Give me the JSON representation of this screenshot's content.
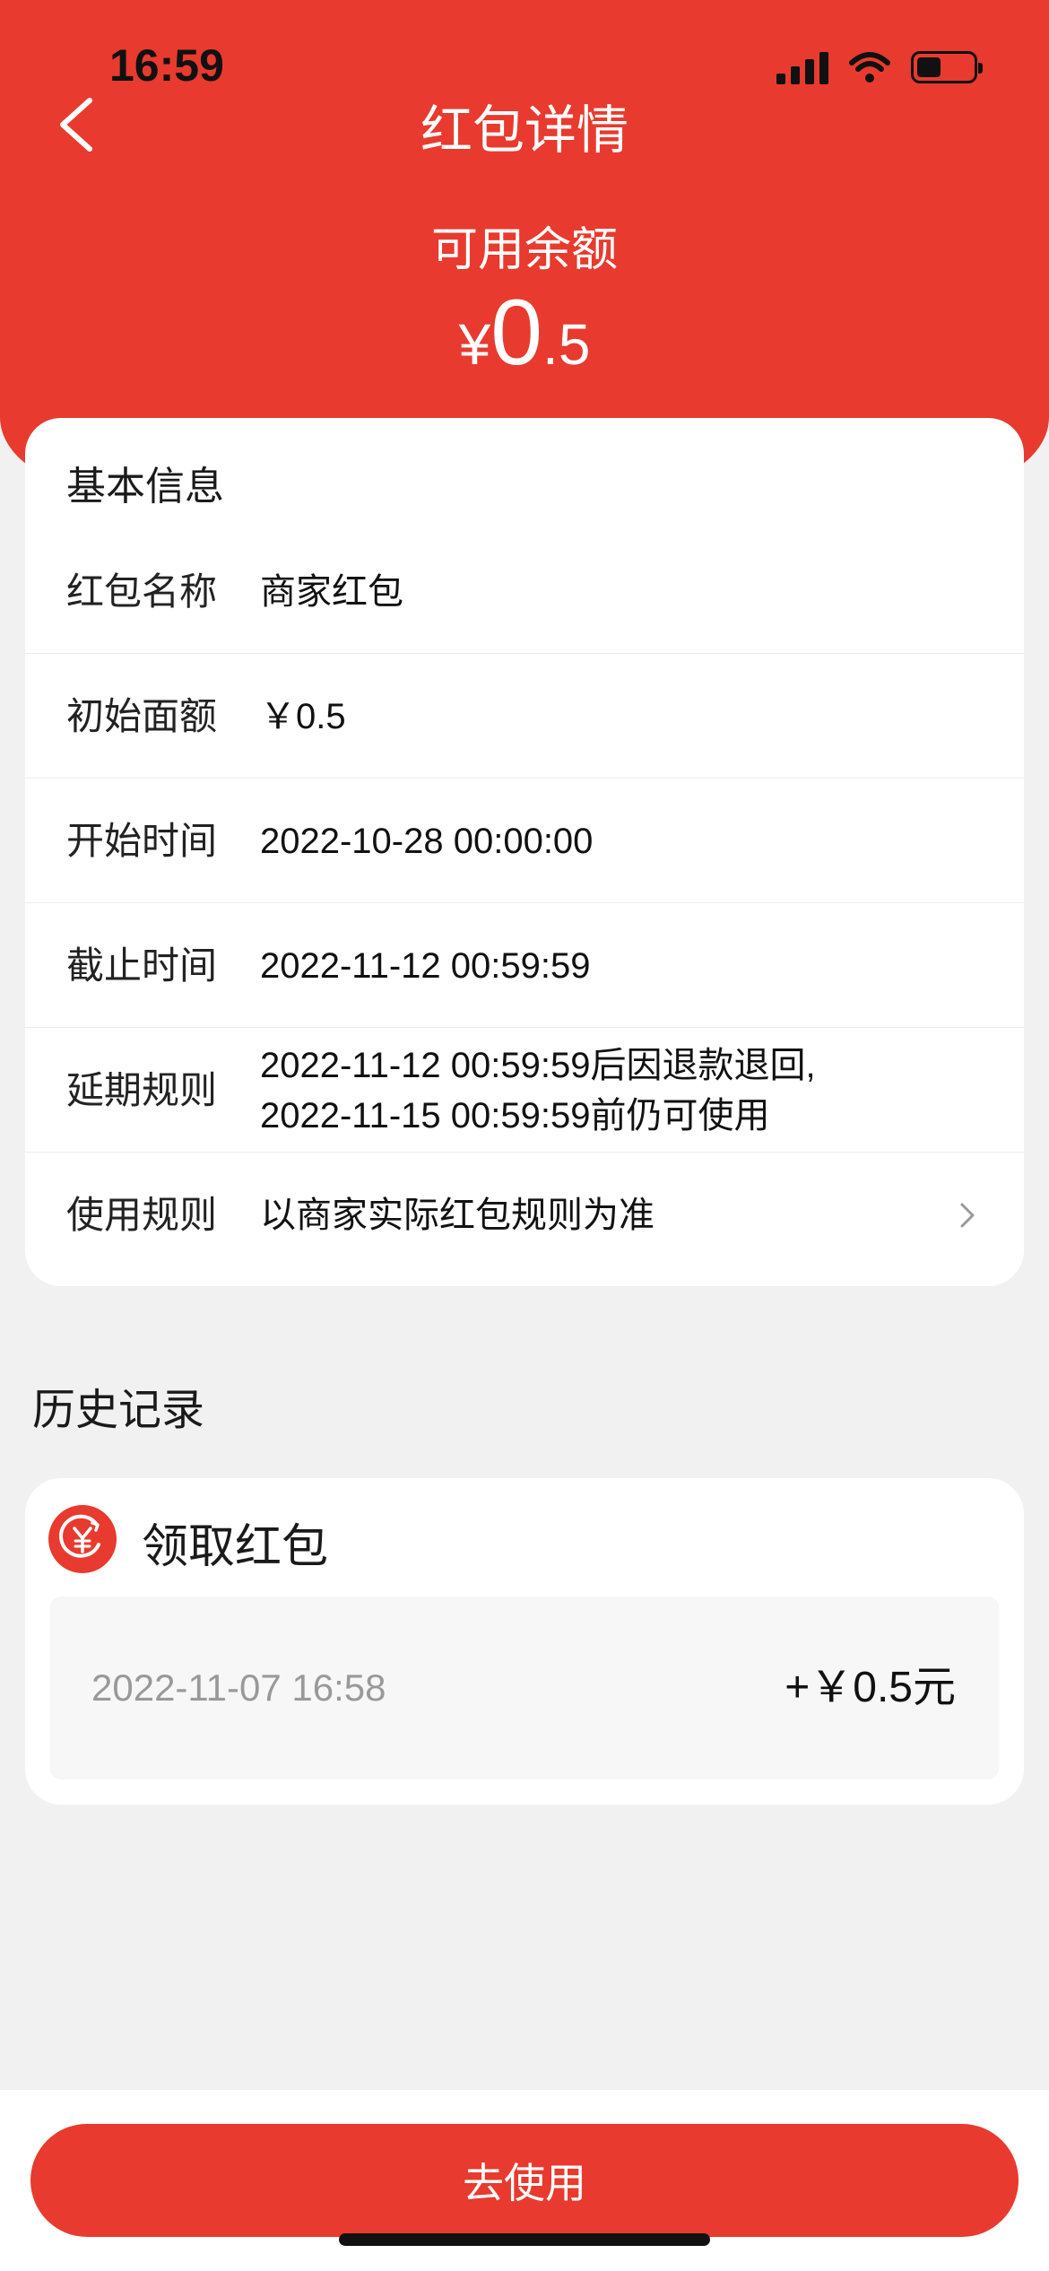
{
  "status_bar": {
    "time": "16:59"
  },
  "nav": {
    "title": "红包详情"
  },
  "balance": {
    "label": "可用余额",
    "currency": "¥",
    "integer": "0",
    "decimal": ".5"
  },
  "basic_info": {
    "heading": "基本信息",
    "rows": [
      {
        "label": "红包名称",
        "value": [
          "商家红包"
        ]
      },
      {
        "label": "初始面额",
        "value": [
          "￥0.5"
        ]
      },
      {
        "label": "开始时间",
        "value": [
          "2022-10-28 00:00:00"
        ]
      },
      {
        "label": "截止时间",
        "value": [
          "2022-11-12 00:59:59"
        ]
      },
      {
        "label": "延期规则",
        "value": [
          "2022-11-12 00:59:59后因退款退回,",
          "2022-11-15 00:59:59前仍可使用"
        ]
      },
      {
        "label": "使用规则",
        "value": [
          "以商家实际红包规则为准"
        ]
      }
    ]
  },
  "history": {
    "title": "历史记录",
    "records": [
      {
        "title": "领取红包",
        "time": "2022-11-07 16:58",
        "amount": "+￥0.5元"
      }
    ]
  },
  "bottom": {
    "button_label": "去使用"
  },
  "colors": {
    "brand_red": "#e83a2e",
    "background": "#f1f1f1"
  }
}
